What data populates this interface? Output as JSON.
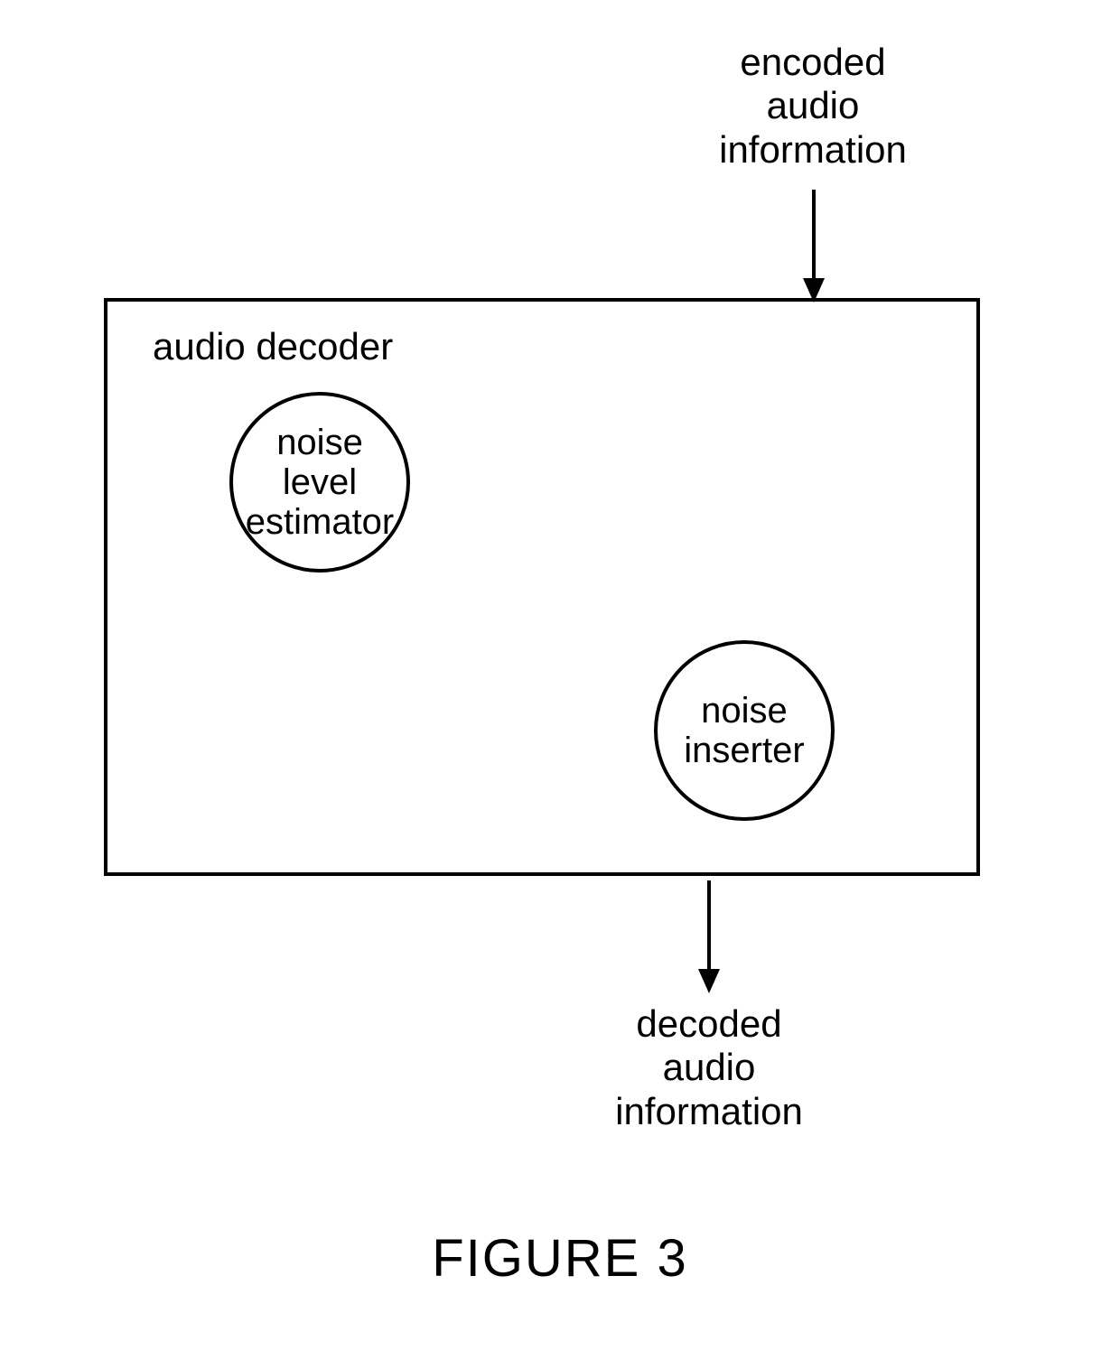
{
  "input": {
    "line1": "encoded",
    "line2": "audio",
    "line3": "information"
  },
  "decoder": {
    "title": "audio decoder",
    "estimator": {
      "line1": "noise",
      "line2": "level",
      "line3": "estimator"
    },
    "inserter": {
      "line1": "noise",
      "line2": "inserter"
    }
  },
  "output": {
    "line1": "decoded",
    "line2": "audio",
    "line3": "information"
  },
  "figure_label": "FIGURE 3"
}
